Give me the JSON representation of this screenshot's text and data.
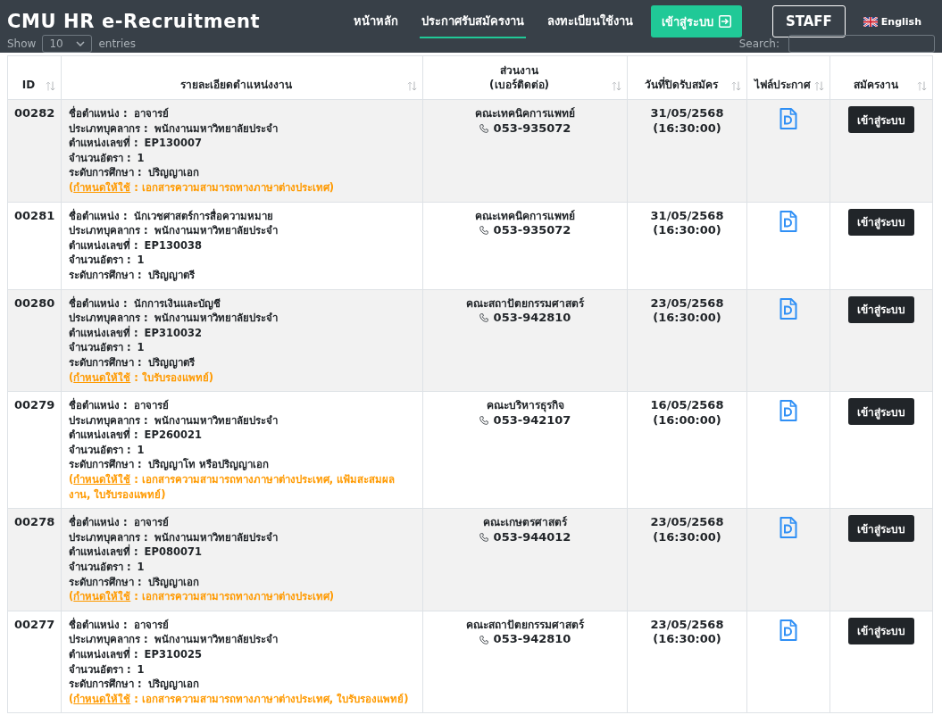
{
  "navbar": {
    "brand": "CMU HR e-Recruitment",
    "links": [
      {
        "label": "หน้าหลัก",
        "selected": false
      },
      {
        "label": "ประกาศรับสมัครงาน",
        "selected": true
      },
      {
        "label": "ลงทะเบียนใช้งาน",
        "selected": false
      }
    ],
    "login_button": "เข้าสู่ระบบ",
    "staff_button": "STAFF",
    "language": "English"
  },
  "toolbar": {
    "length_label_before": "Show",
    "length_value": "10",
    "length_label_after": "entries",
    "search_label": "Search:"
  },
  "table": {
    "columns": [
      {
        "lines": [
          "ID"
        ]
      },
      {
        "lines": [
          "รายละเอียดตำแหน่งงาน"
        ]
      },
      {
        "lines": [
          "ส่วนงาน",
          "(เบอร์ติดต่อ)"
        ]
      },
      {
        "lines": [
          "วันที่ปิดรับสมัคร"
        ]
      },
      {
        "lines": [
          "ไฟล์ประกาศ"
        ]
      },
      {
        "lines": [
          "สมัครงาน"
        ]
      }
    ],
    "rows": [
      {
        "id": "00282",
        "details": [
          {
            "label": "ชื่อตำแหน่ง :",
            "value": "อาจารย์"
          },
          {
            "label": "ประเภทบุคลากร :",
            "value": "พนักงานมหาวิทยาลัยประจำ"
          },
          {
            "label": "ตำแหน่งเลขที่ :",
            "value": "EP130007"
          },
          {
            "label": "จำนวนอัตรา :",
            "value": "1"
          },
          {
            "label": "ระดับการศึกษา :",
            "value": "ปริญญาเอก"
          }
        ],
        "note": {
          "open": "(",
          "link": "กำหนดให้ใช้",
          "rest": " : เอกสารความสามารถทางภาษาต่างประเทศ)"
        },
        "unit": "คณะเทคนิคการแพทย์",
        "phone": "053-935072",
        "close_date": "31/05/2568",
        "close_time": "(16:30:00)",
        "apply_button": "เข้าสู่ระบบ"
      },
      {
        "id": "00281",
        "details": [
          {
            "label": "ชื่อตำแหน่ง :",
            "value": "นักเวชศาสตร์การสื่อความหมาย"
          },
          {
            "label": "ประเภทบุคลากร :",
            "value": "พนักงานมหาวิทยาลัยประจำ"
          },
          {
            "label": "ตำแหน่งเลขที่ :",
            "value": "EP130038"
          },
          {
            "label": "จำนวนอัตรา :",
            "value": "1"
          },
          {
            "label": "ระดับการศึกษา :",
            "value": "ปริญญาตรี"
          }
        ],
        "unit": "คณะเทคนิคการแพทย์",
        "phone": "053-935072",
        "close_date": "31/05/2568",
        "close_time": "(16:30:00)",
        "apply_button": "เข้าสู่ระบบ"
      },
      {
        "id": "00280",
        "details": [
          {
            "label": "ชื่อตำแหน่ง :",
            "value": "นักการเงินและบัญชี"
          },
          {
            "label": "ประเภทบุคลากร :",
            "value": "พนักงานมหาวิทยาลัยประจำ"
          },
          {
            "label": "ตำแหน่งเลขที่ :",
            "value": "EP310032"
          },
          {
            "label": "จำนวนอัตรา :",
            "value": "1"
          },
          {
            "label": "ระดับการศึกษา :",
            "value": "ปริญญาตรี"
          }
        ],
        "note": {
          "open": "(",
          "link": "กำหนดให้ใช้",
          "rest": " : ใบรับรองแพทย์)"
        },
        "unit": "คณะสถาปัตยกรรมศาสตร์",
        "phone": "053-942810",
        "close_date": "23/05/2568",
        "close_time": "(16:30:00)",
        "apply_button": "เข้าสู่ระบบ"
      },
      {
        "id": "00279",
        "details": [
          {
            "label": "ชื่อตำแหน่ง :",
            "value": "อาจารย์"
          },
          {
            "label": "ประเภทบุคลากร :",
            "value": "พนักงานมหาวิทยาลัยประจำ"
          },
          {
            "label": "ตำแหน่งเลขที่ :",
            "value": "EP260021"
          },
          {
            "label": "จำนวนอัตรา :",
            "value": "1"
          },
          {
            "label": "ระดับการศึกษา :",
            "value": "ปริญญาโท หรือปริญญาเอก"
          }
        ],
        "note": {
          "open": "(",
          "link": "กำหนดให้ใช้",
          "rest": " : เอกสารความสามารถทางภาษาต่างประเทศ, แฟ้มสะสมผลงาน, ใบรับรองแพทย์)"
        },
        "unit": "คณะบริหารธุรกิจ",
        "phone": "053-942107",
        "close_date": "16/05/2568",
        "close_time": "(16:00:00)",
        "apply_button": "เข้าสู่ระบบ"
      },
      {
        "id": "00278",
        "details": [
          {
            "label": "ชื่อตำแหน่ง :",
            "value": "อาจารย์"
          },
          {
            "label": "ประเภทบุคลากร :",
            "value": "พนักงานมหาวิทยาลัยประจำ"
          },
          {
            "label": "ตำแหน่งเลขที่ :",
            "value": "EP080071"
          },
          {
            "label": "จำนวนอัตรา :",
            "value": "1"
          },
          {
            "label": "ระดับการศึกษา :",
            "value": "ปริญญาเอก"
          }
        ],
        "note": {
          "open": "(",
          "link": "กำหนดให้ใช้",
          "rest": " : เอกสารความสามารถทางภาษาต่างประเทศ)"
        },
        "unit": "คณะเกษตรศาสตร์",
        "phone": "053-944012",
        "close_date": "23/05/2568",
        "close_time": "(16:30:00)",
        "apply_button": "เข้าสู่ระบบ"
      },
      {
        "id": "00277",
        "details": [
          {
            "label": "ชื่อตำแหน่ง :",
            "value": "อาจารย์"
          },
          {
            "label": "ประเภทบุคลากร :",
            "value": "พนักงานมหาวิทยาลัยประจำ"
          },
          {
            "label": "ตำแหน่งเลขที่ :",
            "value": "EP310025"
          },
          {
            "label": "จำนวนอัตรา :",
            "value": "1"
          },
          {
            "label": "ระดับการศึกษา :",
            "value": "ปริญญาเอก"
          }
        ],
        "note": {
          "open": "(",
          "link": "กำหนดให้ใช้",
          "rest": " : เอกสารความสามารถทางภาษาต่างประเทศ, ใบรับรองแพทย์)"
        },
        "unit": "คณะสถาปัตยกรรมศาสตร์",
        "phone": "053-942810",
        "close_date": "23/05/2568",
        "close_time": "(16:30:00)",
        "apply_button": "เข้าสู่ระบบ"
      }
    ]
  }
}
